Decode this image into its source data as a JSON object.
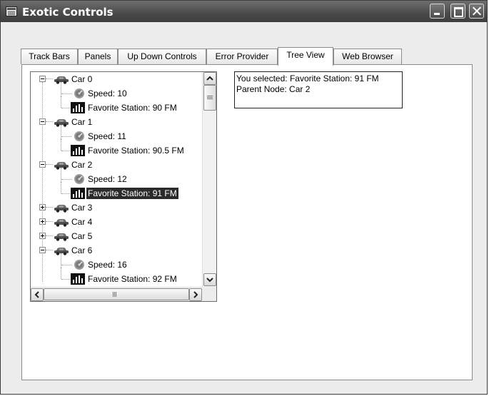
{
  "window": {
    "title": "Exotic Controls"
  },
  "tabs": [
    {
      "label": "Track Bars"
    },
    {
      "label": "Panels"
    },
    {
      "label": "Up Down Controls"
    },
    {
      "label": "Error Provider"
    },
    {
      "label": "Tree View",
      "active": true
    },
    {
      "label": "Web Browser"
    }
  ],
  "tree": {
    "nodes": [
      {
        "label": "Car 0",
        "type": "car",
        "expanded": true
      },
      {
        "label": "Speed: 10",
        "type": "speed"
      },
      {
        "label": "Favorite Station: 90 FM",
        "type": "radio"
      },
      {
        "label": "Car 1",
        "type": "car",
        "expanded": true
      },
      {
        "label": "Speed: 11",
        "type": "speed"
      },
      {
        "label": "Favorite Station: 90.5 FM",
        "type": "radio"
      },
      {
        "label": "Car 2",
        "type": "car",
        "expanded": true
      },
      {
        "label": "Speed: 12",
        "type": "speed"
      },
      {
        "label": "Favorite Station: 91 FM",
        "type": "radio",
        "selected": true
      },
      {
        "label": "Car 3",
        "type": "car",
        "expanded": false
      },
      {
        "label": "Car 4",
        "type": "car",
        "expanded": false
      },
      {
        "label": "Car 5",
        "type": "car",
        "expanded": false
      },
      {
        "label": "Car 6",
        "type": "car",
        "expanded": true
      },
      {
        "label": "Speed: 16",
        "type": "speed"
      },
      {
        "label": "Favorite Station: 92 FM",
        "type": "radio"
      }
    ]
  },
  "info": {
    "selected_line": "You selected: Favorite Station: 91 FM",
    "parent_line": "Parent Node: Car 2"
  },
  "colors": {
    "selection": "#2b2b2b",
    "titlebar": "#4a4a4a"
  }
}
